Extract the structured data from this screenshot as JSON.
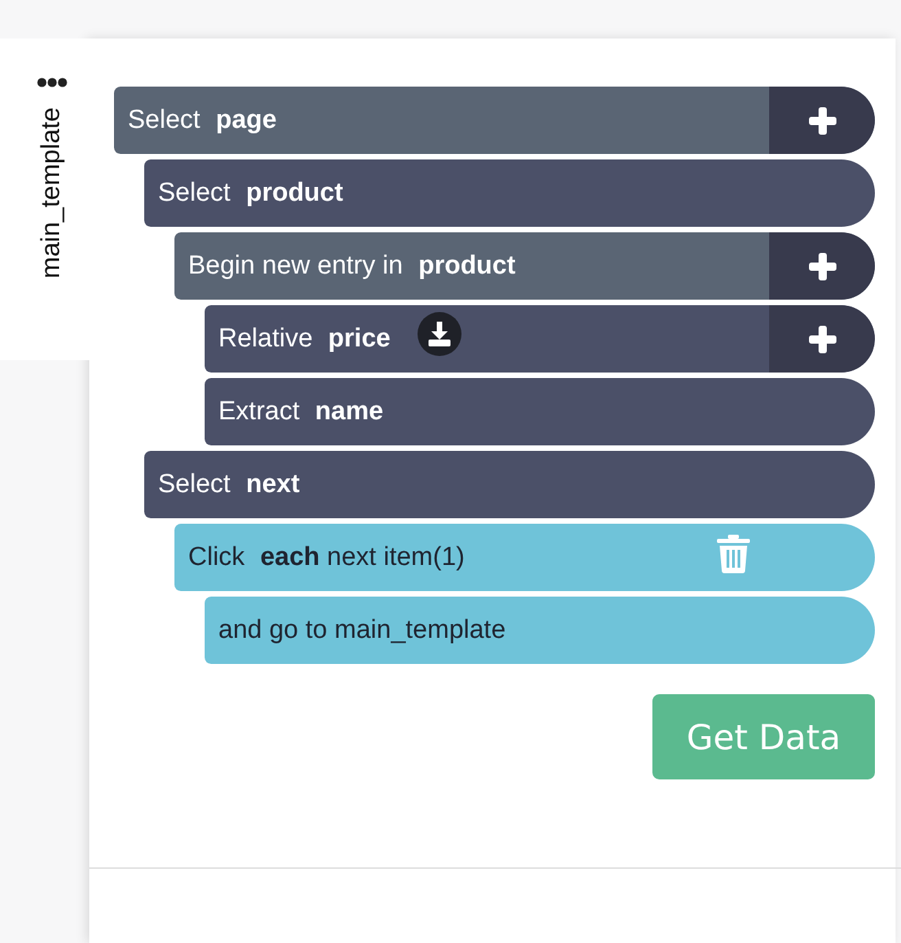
{
  "side_tab": {
    "label": "main_template"
  },
  "steps": [
    {
      "text": "Select **page**",
      "color": "#5a6574",
      "add": true,
      "download": false,
      "delete": false,
      "children": [
        {
          "text": "Select **product**",
          "color": "#4b5068",
          "add": false,
          "download": false,
          "delete": false,
          "children": [
            {
              "text": "Begin new entry in **product**",
              "color": "#5a6574",
              "add": true,
              "download": false,
              "delete": false,
              "children": [
                {
                  "text": "Relative **price**",
                  "color": "#4b5068",
                  "add": true,
                  "download": true,
                  "delete": false
                },
                {
                  "text": "Extract **name**",
                  "color": "#4b5068",
                  "add": false,
                  "download": false,
                  "delete": false
                }
              ]
            }
          ]
        },
        {
          "text": "Select **next**",
          "color": "#4b5068",
          "add": false,
          "download": false,
          "delete": false,
          "children": [
            {
              "text": "Click **each** next item(1)",
              "color": "#6fc3d9",
              "add": false,
              "download": false,
              "delete": true,
              "children": [
                {
                  "text": "and go to main_template",
                  "color": "#6fc3d9",
                  "add": false,
                  "download": false,
                  "delete": false
                }
              ]
            }
          ]
        }
      ]
    }
  ],
  "get_data_button": "Get Data"
}
